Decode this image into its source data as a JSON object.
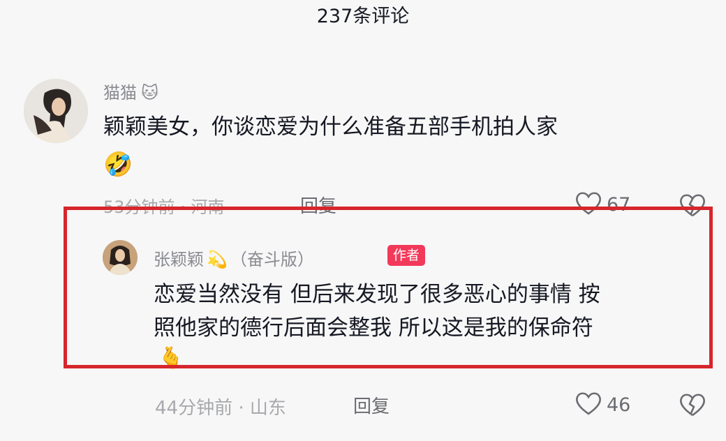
{
  "header": {
    "title": "237条评论"
  },
  "comments": [
    {
      "username": "猫猫",
      "username_emoji": "🐱",
      "text": "颖颖美女，你谈恋爱为什么准备五部手机拍人家",
      "trailing_emoji": "🤣",
      "meta": "53分钟前 · 河南",
      "reply_label": "回复",
      "likes": "67"
    },
    {
      "username": "张颖颖",
      "username_emoji": "💫",
      "suffix": "（奋斗版）",
      "badge": "作者",
      "text_line1": "恋爱当然没有 但后来发现了很多恶心的事情 按",
      "text_line2": "照他家的德行后面会整我 所以这是我的保命符",
      "trailing_emoji": "🫰",
      "meta": "44分钟前 · 山东",
      "reply_label": "回复",
      "likes": "46"
    }
  ],
  "colors": {
    "highlight_border": "#d6262c",
    "badge_bg": "#f2395a"
  },
  "icons": [
    "heart-icon",
    "broken-heart-icon"
  ]
}
